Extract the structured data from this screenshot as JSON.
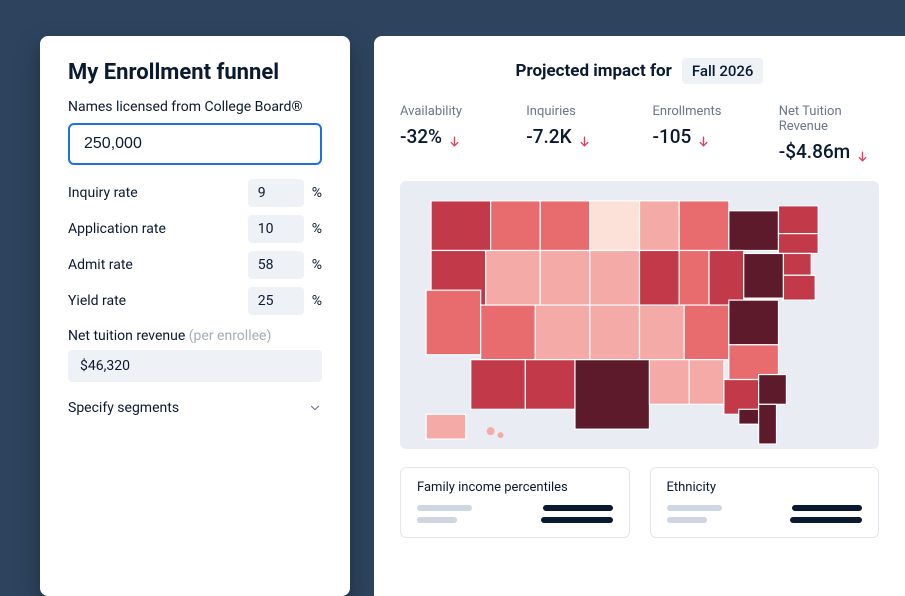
{
  "left": {
    "title": "My Enrollment funnel",
    "names_label": "Names licensed from College Board®",
    "names_value": "250,000",
    "rates": [
      {
        "label": "Inquiry rate",
        "value": "9",
        "suffix": "%"
      },
      {
        "label": "Application rate",
        "value": "10",
        "suffix": "%"
      },
      {
        "label": "Admit rate",
        "value": "58",
        "suffix": "%"
      },
      {
        "label": "Yield rate",
        "value": "25",
        "suffix": "%"
      }
    ],
    "net_label": "Net tuition revenue ",
    "net_hint": "(per enrollee)",
    "net_value": "$46,320",
    "segments_label": "Specify segments"
  },
  "right": {
    "title": "Projected impact for",
    "period": "Fall 2026",
    "metrics": [
      {
        "label": "Availability",
        "value": "-32%"
      },
      {
        "label": "Inquiries",
        "value": "-7.2K"
      },
      {
        "label": "Enrollments",
        "value": "-105"
      },
      {
        "label": "Net Tuition Revenue",
        "value": "-$4.86m"
      }
    ],
    "subcards": [
      {
        "title": "Family income percentiles"
      },
      {
        "title": "Ethnicity"
      }
    ],
    "map_colors": {
      "darkest": "#5d1a2b",
      "dark": "#c2394a",
      "med": "#e86b6e",
      "light": "#f4aaa6",
      "pale": "#fbe1d8",
      "bg": "#e9ecf3"
    }
  }
}
